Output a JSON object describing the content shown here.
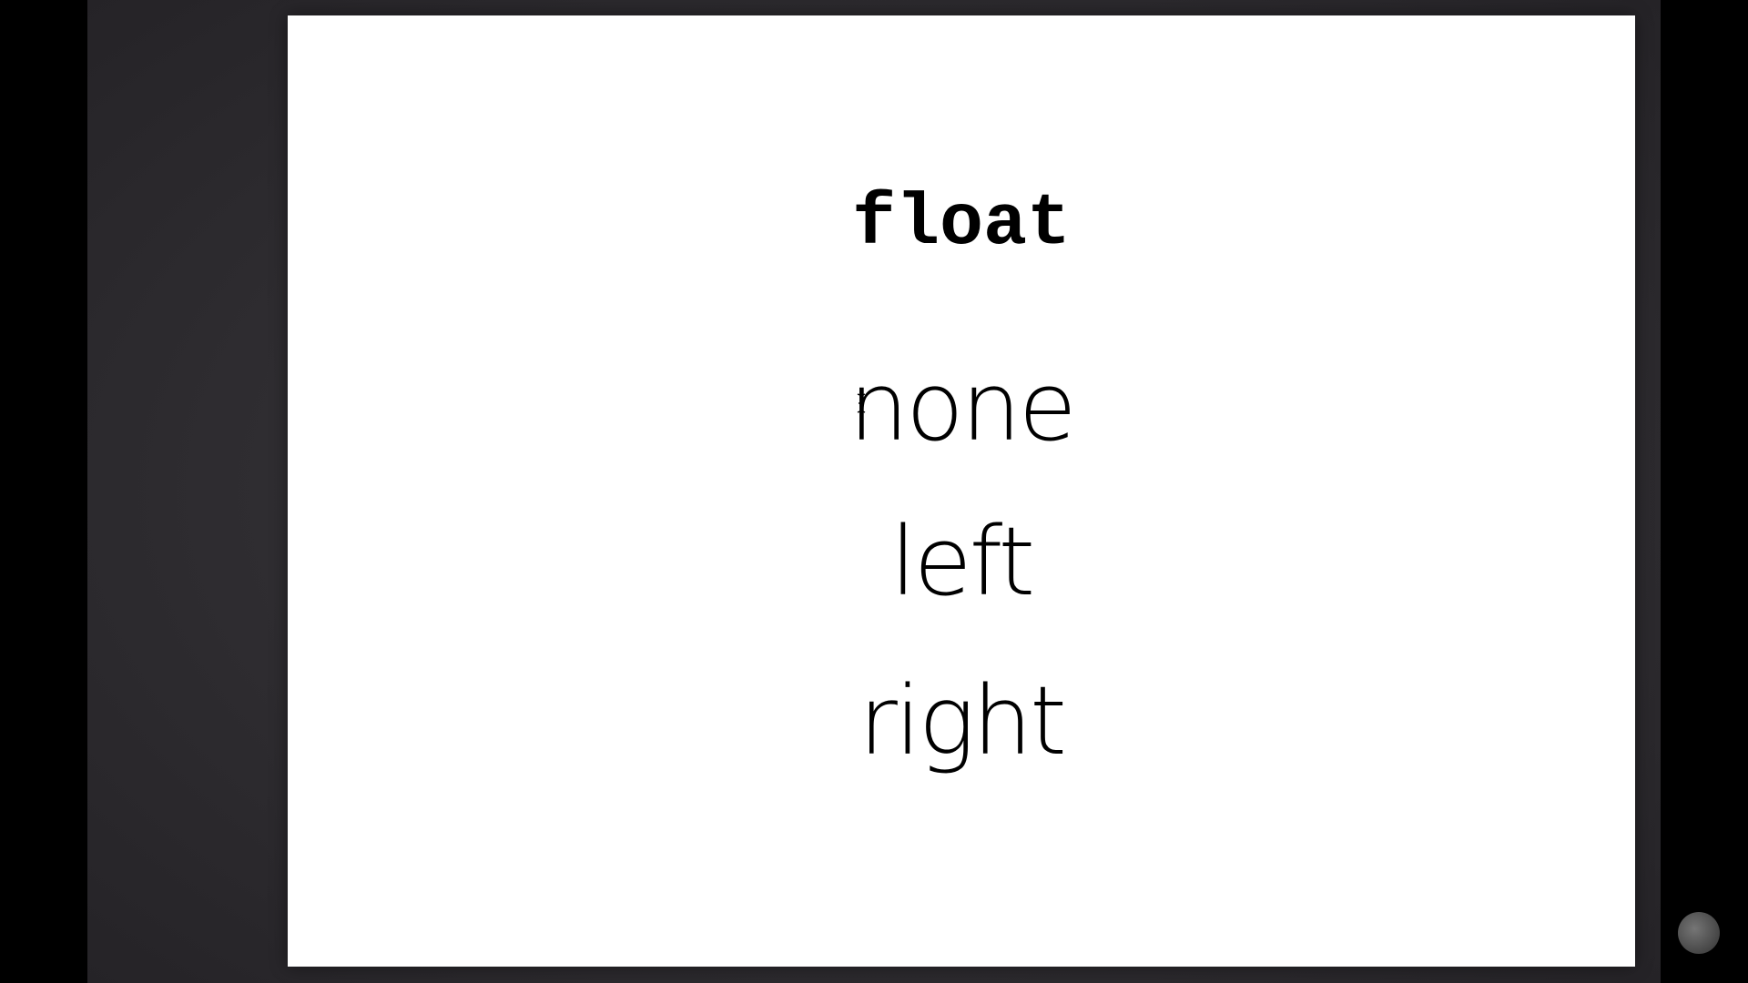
{
  "slide": {
    "title": "float",
    "options": [
      "none",
      "left",
      "right"
    ]
  },
  "colors": {
    "background": "#2f2d31",
    "slide": "#ffffff",
    "text": "#000000"
  },
  "icons": {
    "cursor": "text-cursor-icon",
    "corner": "channel-logo-icon"
  }
}
